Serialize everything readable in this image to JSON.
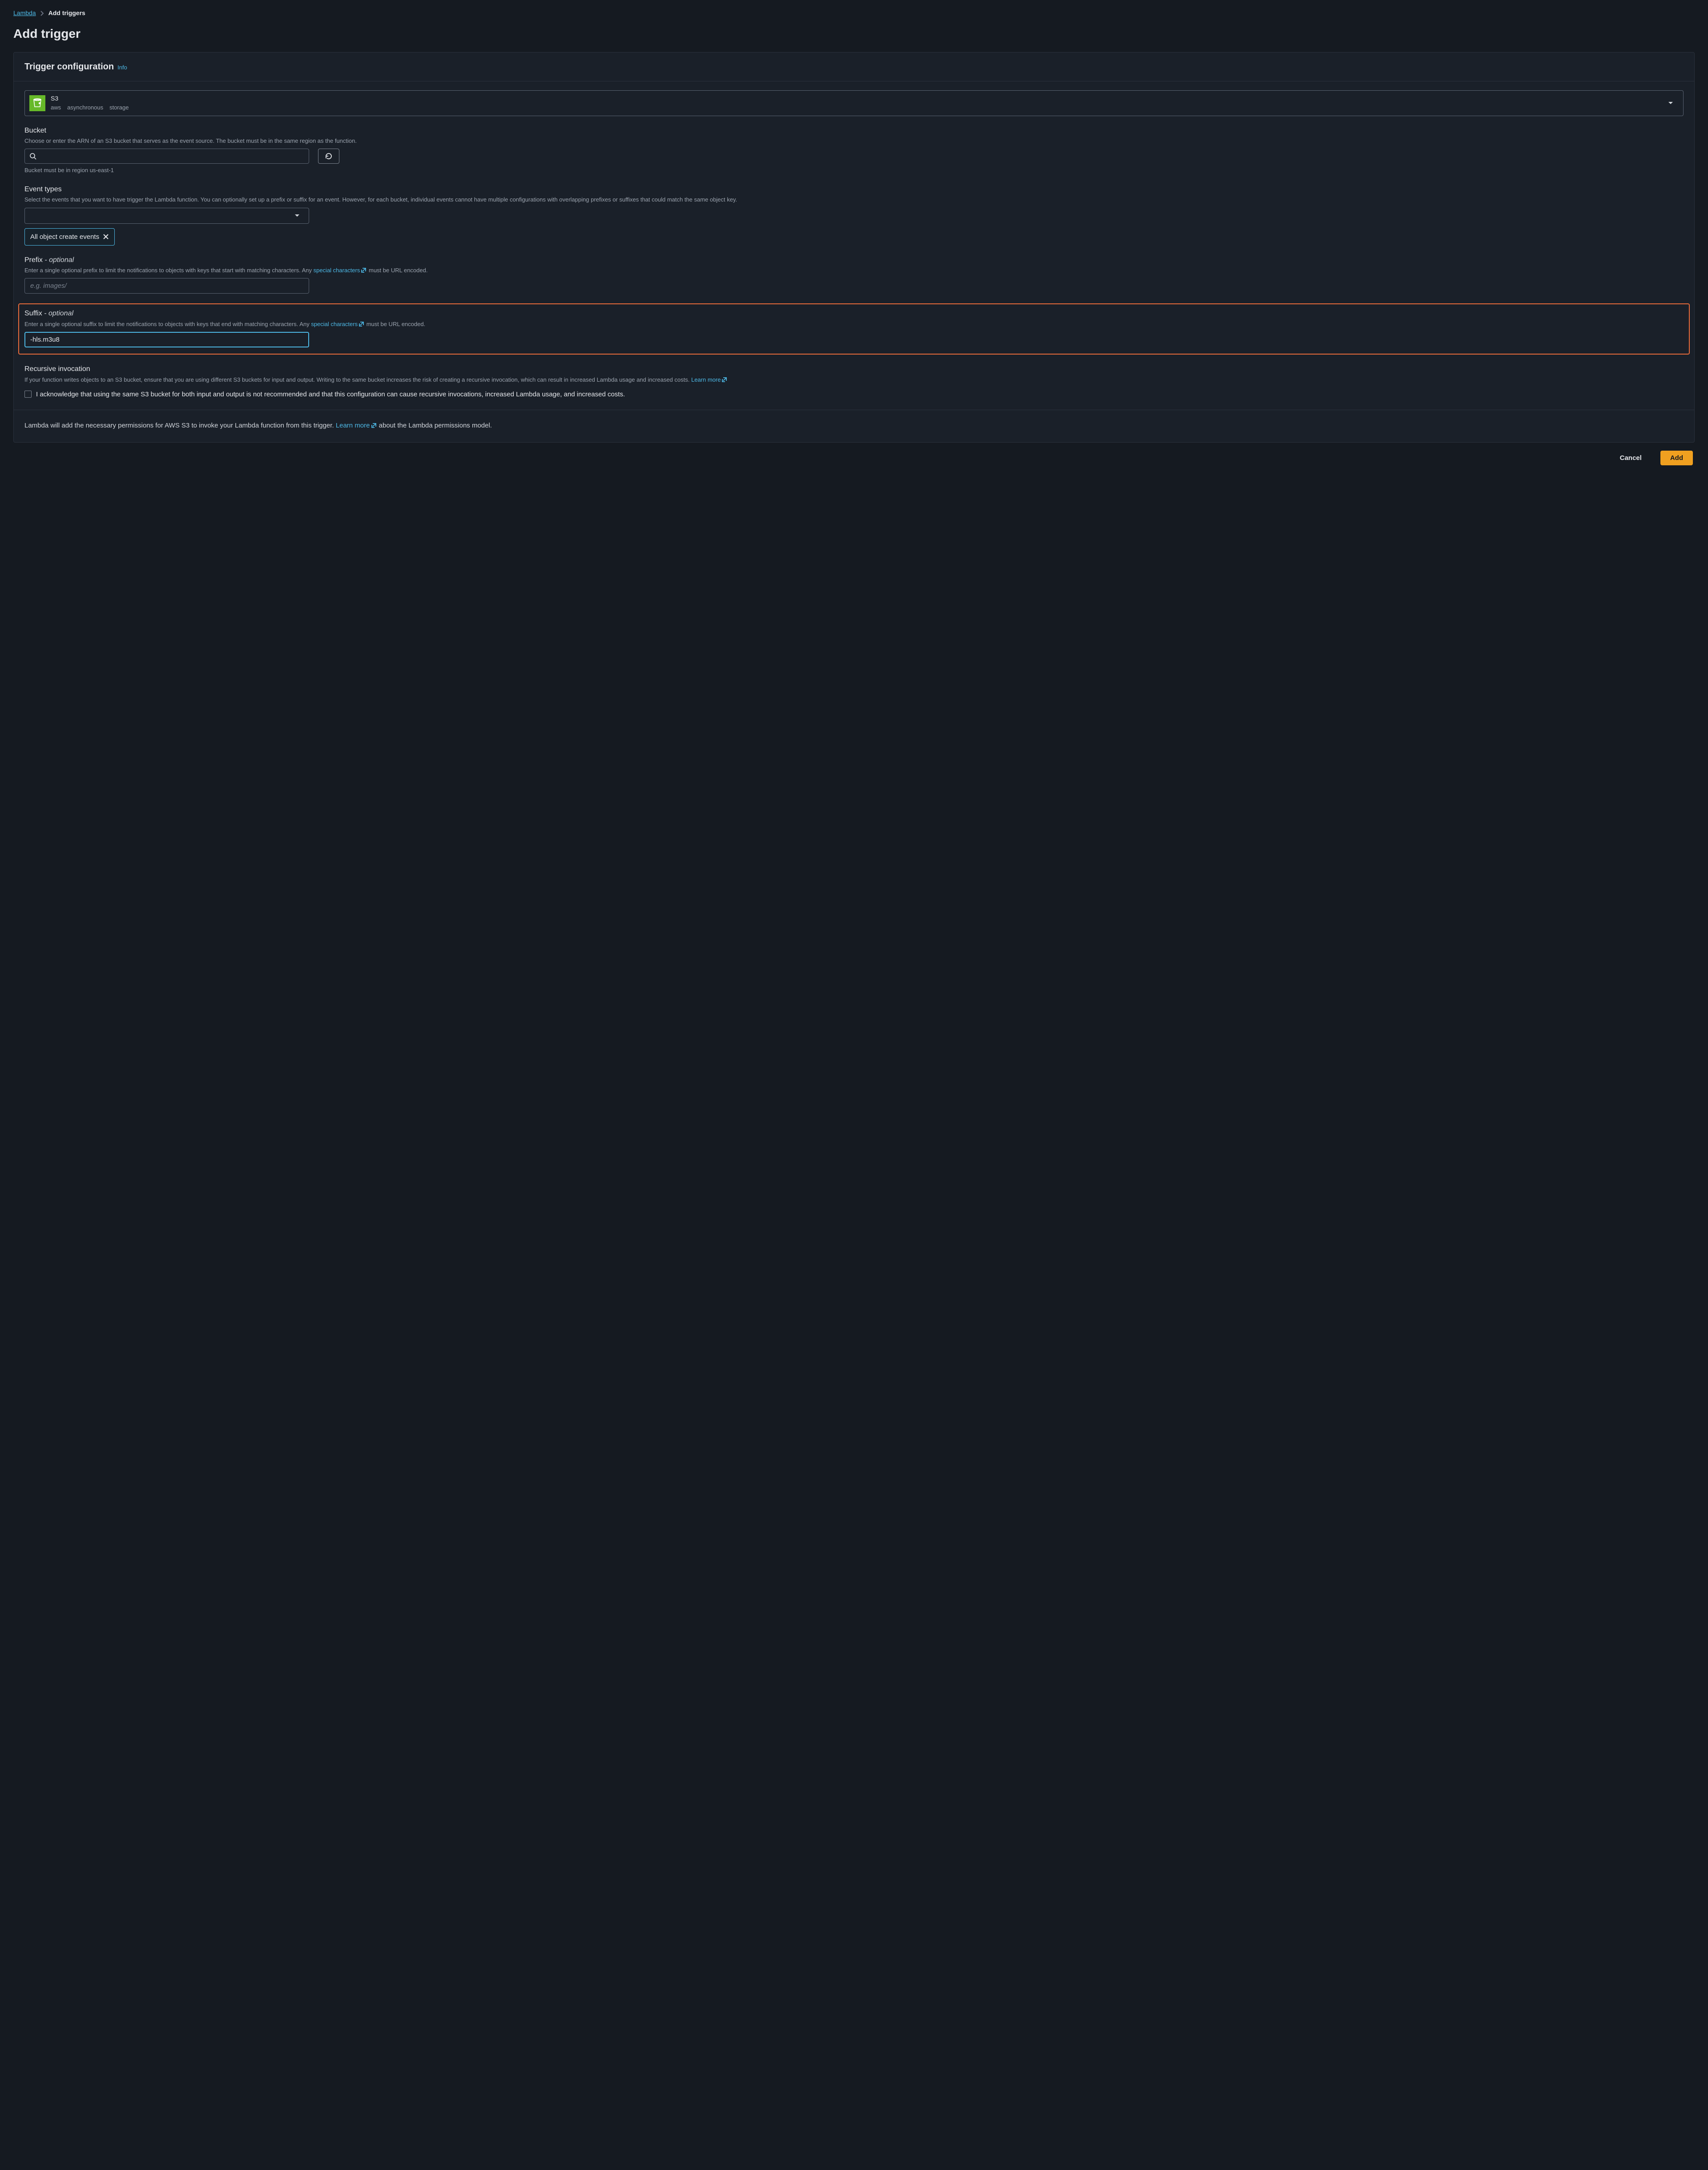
{
  "breadcrumb": {
    "root": "Lambda",
    "current": "Add triggers"
  },
  "page_title": "Add trigger",
  "card": {
    "title": "Trigger configuration",
    "info": "Info"
  },
  "source": {
    "name": "S3",
    "tag1": "aws",
    "tag2": "asynchronous",
    "tag3": "storage"
  },
  "bucket": {
    "label": "Bucket",
    "help": "Choose or enter the ARN of an S3 bucket that serves as the event source. The bucket must be in the same region as the function.",
    "hint": "Bucket must be in region us-east-1"
  },
  "event_types": {
    "label": "Event types",
    "help": "Select the events that you want to have trigger the Lambda function. You can optionally set up a prefix or suffix for an event. However, for each bucket, individual events cannot have multiple configurations with overlapping prefixes or suffixes that could match the same object key.",
    "chip": "All object create events"
  },
  "prefix": {
    "label": "Prefix",
    "optional_tag": " - optional",
    "help_pre": "Enter a single optional prefix to limit the notifications to objects with keys that start with matching characters. Any ",
    "help_link": "special characters",
    "help_post": " must be URL encoded.",
    "placeholder": "e.g. images/",
    "value": ""
  },
  "suffix": {
    "label": "Suffix",
    "optional_tag": " - optional",
    "help_pre": "Enter a single optional suffix to limit the notifications to objects with keys that end with matching characters. Any ",
    "help_link": "special characters",
    "help_post": " must be URL encoded.",
    "value": "-hls.m3u8"
  },
  "recursive": {
    "label": "Recursive invocation",
    "help_pre": "If your function writes objects to an S3 bucket, ensure that you are using different S3 buckets for input and output. Writing to the same bucket increases the risk of creating a recursive invocation, which can result in increased Lambda usage and increased costs. ",
    "learn_more": "Learn more",
    "ack": "I acknowledge that using the same S3 bucket for both input and output is not recommended and that this configuration can cause recursive invocations, increased Lambda usage, and increased costs."
  },
  "permissions": {
    "text_pre": "Lambda will add the necessary permissions for AWS S3 to invoke your Lambda function from this trigger. ",
    "learn_more": "Learn more",
    "text_post": " about the Lambda permissions model."
  },
  "footer": {
    "cancel": "Cancel",
    "add": "Add"
  }
}
